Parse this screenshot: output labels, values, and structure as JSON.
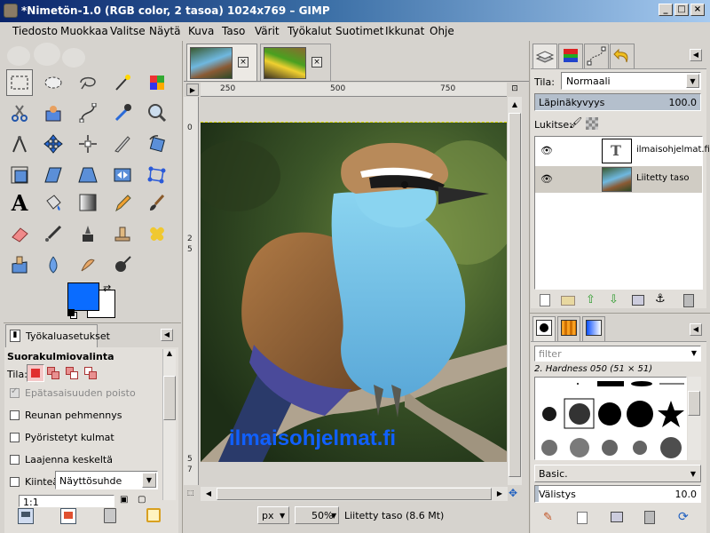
{
  "window": {
    "title": "*Nimetön-1.0 (RGB color, 2 tasoa) 1024x769 – GIMP",
    "min": "_",
    "max": "□",
    "close": "×"
  },
  "menu": [
    "Tiedosto",
    "Muokkaa",
    "Valitse",
    "Näytä",
    "Kuva",
    "Taso",
    "Värit",
    "Työkalut",
    "Suotimet",
    "Ikkunat",
    "Ohje"
  ],
  "toolbox": {
    "options_tab": "Työkaluasetukset",
    "tool_title": "Suorakulmiovalinta",
    "mode_label": "Tila:",
    "antialias": "Epätasaisuuden poisto",
    "feather": "Reunan pehmennys",
    "rounded": "Pyöristetyt kulmat",
    "expand": "Laajenna keskeltä",
    "fixed_label": "Kiinteä:",
    "fixed_value": "Näyttösuhde",
    "ratio_value": "1:1",
    "fg_color": "#0a6cff",
    "bg_color": "#ffffff"
  },
  "image": {
    "watermark": "ilmaisohjelmat.fi",
    "ruler_h": [
      "250",
      "500",
      "750"
    ],
    "ruler_v": [
      "0",
      "2",
      "5",
      "5",
      "7",
      "5"
    ],
    "unit": "px",
    "zoom": "50%",
    "status": "Liitetty taso (8.6 Mt)"
  },
  "layers": {
    "mode_label": "Tila:",
    "mode_value": "Normaali",
    "opacity_label": "Läpinäkyvyys",
    "opacity_value": "100.0",
    "opacity_level": 1.0,
    "lock_label": "Lukitse:",
    "items": [
      {
        "name": "ilmaisohjelmat.fi"
      },
      {
        "name": "Liitetty taso"
      }
    ]
  },
  "brushes": {
    "filter_placeholder": "filter",
    "current": "2. Hardness 050 (51 × 51)",
    "preset": "Basic.",
    "spacing_label": "Välistys",
    "spacing_value": "10.0"
  }
}
